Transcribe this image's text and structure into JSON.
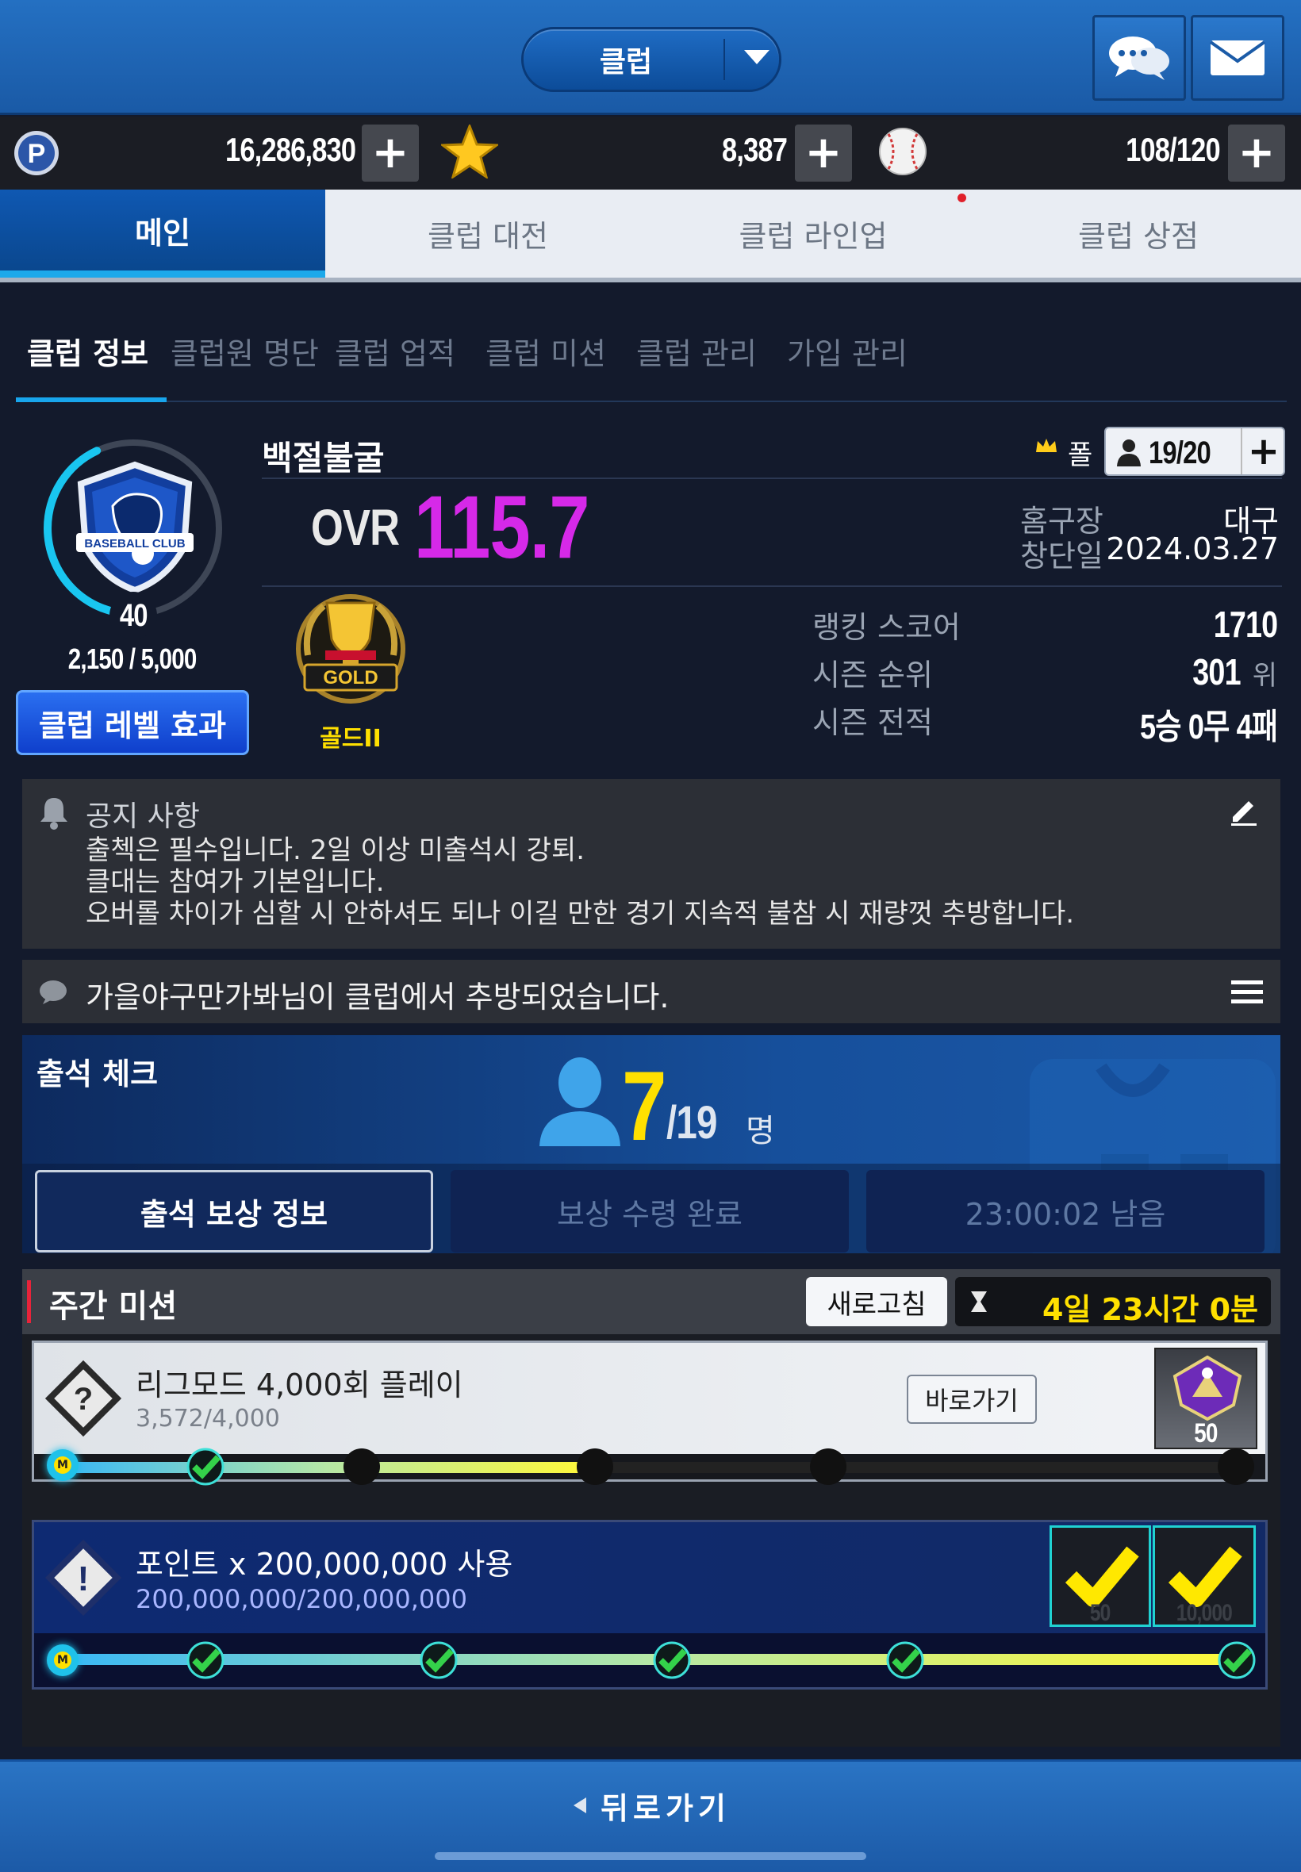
{
  "header": {
    "club_select_label": "클럽",
    "chat_icon": "chat-bubbles-icon",
    "mail_icon": "envelope-icon"
  },
  "currency": {
    "points": "16,286,830",
    "stars": "8,387",
    "balls": "108/120"
  },
  "main_tabs": [
    "메인",
    "클럽 대전",
    "클럽 라인업",
    "클럽 상점"
  ],
  "sub_tabs": [
    "클럽 정보",
    "클럽원 명단",
    "클럽 업적",
    "클럽 미션",
    "클럽 관리",
    "가입 관리"
  ],
  "club": {
    "name": "백절불굴",
    "emblem_text": "BASEBALL CLUB",
    "level": "40",
    "exp": "2,150 / 5,000",
    "exp_fraction": 0.43,
    "level_effect_button": "클럽 레벨 효과",
    "ovr_label": "OVR",
    "ovr_value": "115.7",
    "leader_label": "폴",
    "members": "19/20",
    "home_label": "홈구장",
    "home_value": "대구",
    "founded_label": "창단일",
    "founded_value": "2024.03.27",
    "tier_badge": "GOLD",
    "tier_label": "골드II",
    "ranking_score_label": "랭킹 스코어",
    "ranking_score_value": "1710",
    "season_rank_label": "시즌 순위",
    "season_rank_value": "301",
    "season_rank_unit": "위",
    "season_record_label": "시즌 전적",
    "season_record_value": "5승 0무 4패"
  },
  "notice": {
    "title": "공지 사항",
    "lines": [
      "출첵은 필수입니다. 2일 이상 미출석시 강퇴.",
      "클대는 참여가 기본입니다.",
      "오버롤 차이가 심할 시 안하셔도 되나 이길 만한 경기 지속적 불참 시 재량껏 추방합니다."
    ]
  },
  "event_log": {
    "text": "가을야구만가봐님이 클럽에서 추방되었습니다."
  },
  "attendance": {
    "title": "출석 체크",
    "count": "7",
    "total": "/19",
    "unit": "명",
    "buttons": [
      "출석 보상 정보",
      "보상 수령 완료",
      "23:00:02 남음"
    ]
  },
  "weekly_missions": {
    "title": "주간 미션",
    "refresh_label": "새로고침",
    "time_left": "4일 23시간 0분",
    "items": [
      {
        "title": "리그모드 4,000회 플레이",
        "progress": "3,572/4,000",
        "progress_fraction": 0.893,
        "goto_label": "바로가기",
        "reward_count": "50"
      },
      {
        "title": "포인트 x 200,000,000 사용",
        "progress": "200,000,000/200,000,000",
        "progress_fraction": 1.0,
        "reward_counts": [
          "50",
          "10,000"
        ]
      }
    ]
  },
  "footer": {
    "back_label": "뒤로가기"
  },
  "colors": {
    "accent_blue": "#18a5ec",
    "ovr_magenta": "#d629e8",
    "gold": "#ffe000"
  }
}
